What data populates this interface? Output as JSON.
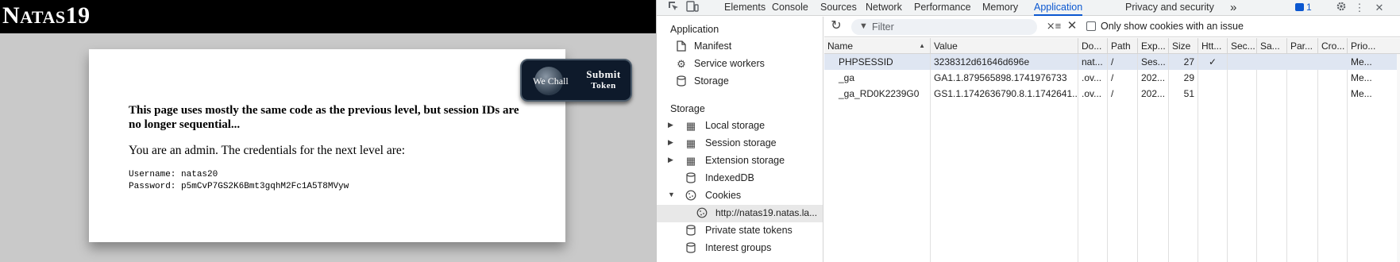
{
  "page": {
    "title_first": "N",
    "title_sc": "ATAS",
    "title_num": "19",
    "submit_badge": "We Chall",
    "submit_line1": "Submit",
    "submit_line2": "Token",
    "description": "This page uses mostly the same code as the previous level, but session IDs are no longer sequential...",
    "admin_message": "You are an admin. The credentials for the next level are:",
    "username_line": "Username: natas20",
    "password_line": "Password: p5mCvP7GS2K6Bmt3gqhM2Fc1A5T8MVyw"
  },
  "devtools": {
    "tabs": [
      "Elements",
      "Console",
      "Sources",
      "Network",
      "Performance",
      "Memory",
      "Application",
      "Privacy and security"
    ],
    "active_tab": "Application",
    "more_tabs": "»",
    "issues_count": "1",
    "sidebar": {
      "application_heading": "Application",
      "application_items": [
        "Manifest",
        "Service workers",
        "Storage"
      ],
      "storage_heading": "Storage",
      "storage_items": [
        "Local storage",
        "Session storage",
        "Extension storage",
        "IndexedDB",
        "Cookies",
        "http://natas19.natas.la...",
        "Private state tokens",
        "Interest groups"
      ]
    },
    "toolbar": {
      "filter_placeholder": "Filter",
      "only_issue_label": "Only show cookies with an issue"
    },
    "cookies": {
      "columns": [
        "Name",
        "Value",
        "Do...",
        "Path",
        "Exp...",
        "Size",
        "Htt...",
        "Sec...",
        "Sa...",
        "Par...",
        "Cro...",
        "Prio..."
      ],
      "rows": [
        [
          "PHPSESSID",
          "3238312d61646d696e",
          "nat...",
          "/",
          "Ses...",
          "27",
          "✓",
          "",
          "",
          "",
          "",
          "Me..."
        ],
        [
          "_ga",
          "GA1.1.879565898.1741976733",
          ".ov...",
          "/",
          "202...",
          "29",
          "",
          "",
          "",
          "",
          "",
          "Me..."
        ],
        [
          "_ga_RD0K2239G0",
          "GS1.1.1742636790.8.1.1742641...",
          ".ov...",
          "/",
          "202...",
          "51",
          "",
          "",
          "",
          "",
          "",
          "Me..."
        ]
      ]
    }
  },
  "colors": {
    "accent": "#0b57d0",
    "selected_row": "#dfe6f2",
    "page_background": "#c9c9c9",
    "header_background": "#000000"
  }
}
